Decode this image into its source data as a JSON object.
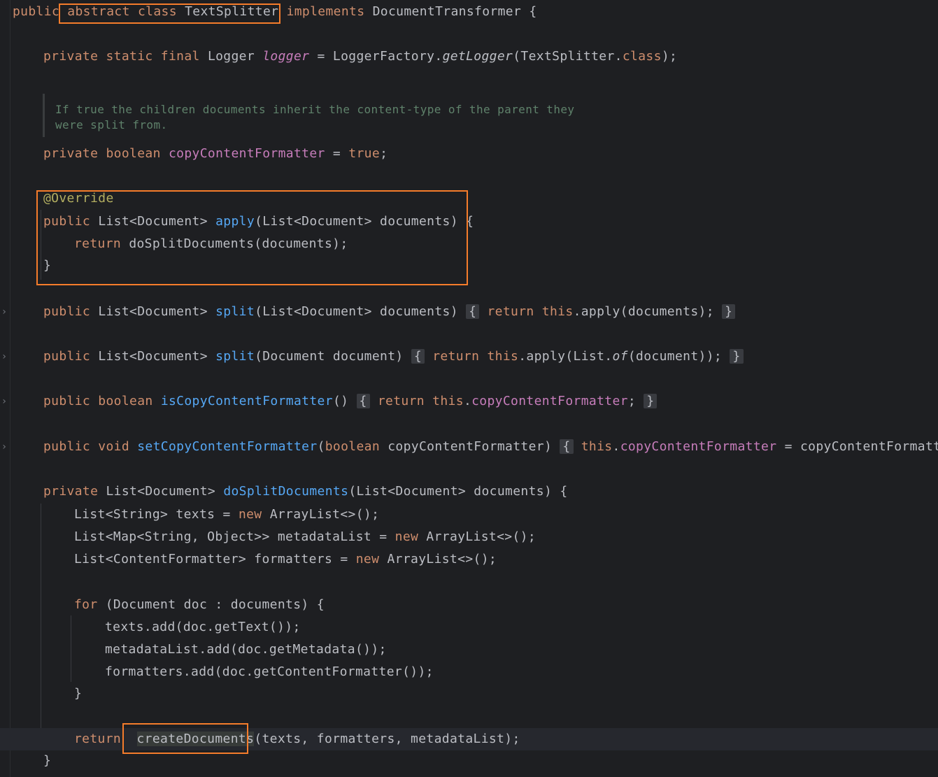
{
  "code": {
    "l1": {
      "a": "public",
      "b": " abstract class ",
      "c": "TextSplitter",
      "d": " implements ",
      "e": "DocumentTransformer {"
    },
    "l2": {
      "a": "private static final ",
      "b": "Logger ",
      "c": "logger",
      "d": " = LoggerFactory.",
      "e": "getLogger",
      "f": "(TextSplitter.",
      "g": "class",
      "h": ");"
    },
    "doc1": "If true the children documents inherit the content-type of the parent they",
    "doc2": "were split from.",
    "l3": {
      "a": "private boolean ",
      "b": "copyContentFormatter",
      "c": " = ",
      "d": "true",
      "e": ";"
    },
    "l4": "@Override",
    "l5": {
      "a": "public ",
      "b": "List<Document> ",
      "c": "apply",
      "d": "(List<Document> documents) {"
    },
    "l6": {
      "a": "return ",
      "b": "doSplitDocuments(documents);"
    },
    "l7": "}",
    "l8": {
      "a": "public ",
      "b": "List<Document> ",
      "c": "split",
      "d": "(List<Document> documents)",
      "e": "{",
      "f": "return this",
      "g": ".apply(documents);",
      "h": "}"
    },
    "l9": {
      "a": "public ",
      "b": "List<Document> ",
      "c": "split",
      "d": "(Document document)",
      "e": "{",
      "f": "return this",
      "g": ".apply(List.",
      "h": "of",
      "i": "(document));",
      "j": "}"
    },
    "l10": {
      "a": "public boolean ",
      "b": "isCopyContentFormatter",
      "c": "()",
      "d": "{",
      "e": "return this",
      "f": ".",
      "g": "copyContentFormatter",
      "h": ";",
      "i": "}"
    },
    "l11": {
      "a": "public void ",
      "b": "setCopyContentFormatter",
      "c": "(",
      "d": "boolean ",
      "e": "copyContentFormatter)",
      "f": "{",
      "g": "this",
      "h": ".",
      "i": "copyContentFormatter",
      "j": " = copyContentFormatter"
    },
    "l12": {
      "a": "private ",
      "b": "List<Document> ",
      "c": "doSplitDocuments",
      "d": "(List<Document> documents) {"
    },
    "l13": {
      "a": "List<String> texts = ",
      "b": "new ",
      "c": "ArrayList<>();"
    },
    "l14": {
      "a": "List<Map<String, Object>> metadataList = ",
      "b": "new ",
      "c": "ArrayList<>();"
    },
    "l15": {
      "a": "List<ContentFormatter> formatters = ",
      "b": "new ",
      "c": "ArrayList<>();"
    },
    "l16": {
      "a": "for ",
      "b": "(Document doc : documents) {"
    },
    "l17": "texts.add(doc.getText());",
    "l18": "metadataList.add(doc.getMetadata());",
    "l19": "formatters.add(doc.getContentFormatter());",
    "l20": "}",
    "l21": {
      "a": "return ",
      "b": "createDocuments",
      "c": "(texts, formatters, metadataList);"
    },
    "l22": "}"
  },
  "fold_marker": "›",
  "colors": {
    "highlight_border": "#f57c2b",
    "keyword": "#cf8e6d",
    "function": "#56a8f5",
    "field": "#c77dbb",
    "comment": "#5f826b",
    "annotation": "#b3ae60"
  }
}
